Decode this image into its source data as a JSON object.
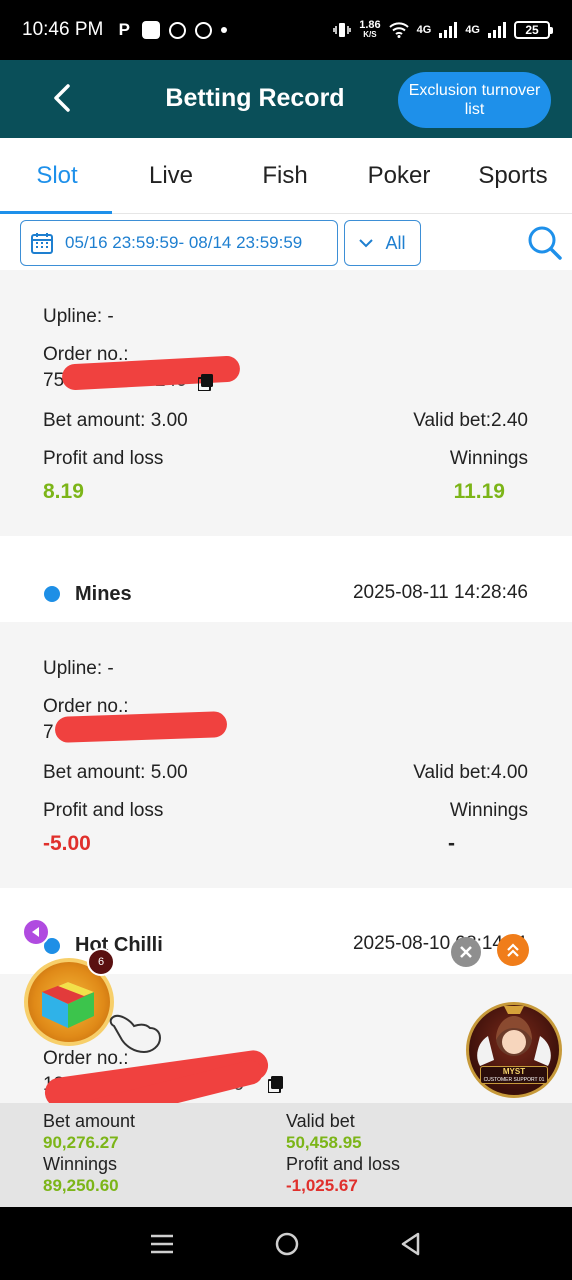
{
  "status_bar": {
    "time": "10:46 PM",
    "app_icon_p": "P",
    "speed_value": "1.86",
    "speed_unit": "K/S",
    "net1": "4G",
    "net2": "4G",
    "battery": "25"
  },
  "header": {
    "title": "Betting Record",
    "exclusion_button": "Exclusion turnover list"
  },
  "tabs": [
    {
      "label": "Slot",
      "active": true
    },
    {
      "label": "Live",
      "active": false
    },
    {
      "label": "Fish",
      "active": false
    },
    {
      "label": "Poker",
      "active": false
    },
    {
      "label": "Sports",
      "active": false
    }
  ],
  "filter": {
    "date_range": "05/16 23:59:59- 08/14 23:59:59",
    "type": "All"
  },
  "records": [
    {
      "upline": "Upline: -",
      "order_label": "Order no.:",
      "order_prefix": "75",
      "order_suffix": "240",
      "bet_amount": "Bet amount: 3.00",
      "valid_bet": "Valid bet:2.40",
      "pl_label": "Profit and loss",
      "pl_value": "8.19",
      "win_label": "Winnings",
      "win_value": "11.19"
    },
    {
      "game": "Mines",
      "time": "2025-08-11 14:28:46",
      "upline": "Upline: -",
      "order_label": "Order no.:",
      "order_prefix": "7",
      "bet_amount": "Bet amount: 5.00",
      "valid_bet": "Valid bet:4.00",
      "pl_label": "Profit and loss",
      "pl_value": "-5.00",
      "win_label": "Winnings",
      "win_value": "-"
    },
    {
      "game": "Hot Chilli",
      "time": "2025-08-10 08:14:11",
      "order_label": "Order no.:",
      "order_prefix": "1863",
      "order_suffix": "006"
    }
  ],
  "summary": {
    "bet_label": "Bet amount",
    "bet_value": "90,276.27",
    "valid_label": "Valid bet",
    "valid_value": "50,458.95",
    "win_label": "Winnings",
    "win_value": "89,250.60",
    "pl_label": "Profit and loss",
    "pl_value": "-1,025.67"
  },
  "floating": {
    "gift_badge": "6",
    "support_name": "MYST",
    "support_caption": "CUSTOMER SUPPORT 01"
  },
  "colors": {
    "header_bg": "#0a4f59",
    "accent_blue": "#1e90ea",
    "profit_green": "#7cb518",
    "loss_red": "#e0302c"
  }
}
